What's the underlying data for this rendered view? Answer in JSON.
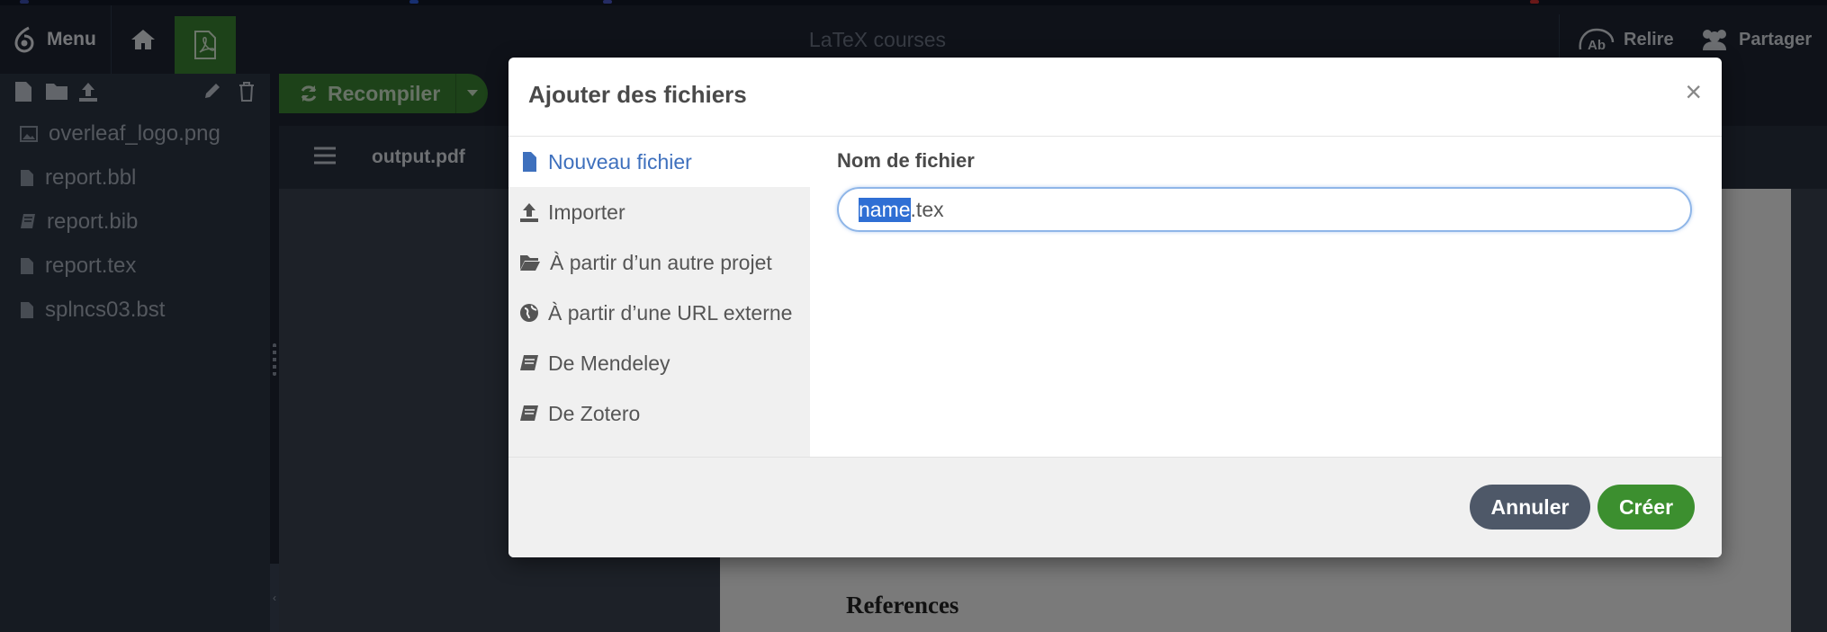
{
  "toolbar": {
    "menu_label": "Menu",
    "project_title": "LaTeX courses",
    "review_label": "Relire",
    "share_label": "Partager"
  },
  "sidebar": {
    "files": [
      {
        "name": "overleaf_logo.png",
        "icon": "image-icon"
      },
      {
        "name": "report.bbl",
        "icon": "file-icon"
      },
      {
        "name": "report.bib",
        "icon": "book-icon"
      },
      {
        "name": "report.tex",
        "icon": "file-icon"
      },
      {
        "name": "splncs03.bst",
        "icon": "file-icon"
      }
    ]
  },
  "pdf": {
    "recompile_label": "Recompiler",
    "output_filename": "output.pdf",
    "page_heading": "References"
  },
  "modal": {
    "title": "Ajouter des fichiers",
    "close_glyph": "×",
    "nav": [
      {
        "label": "Nouveau fichier",
        "icon": "file-icon",
        "active": true
      },
      {
        "label": "Importer",
        "icon": "upload-icon",
        "active": false
      },
      {
        "label": "À partir d’un autre projet",
        "icon": "folder-open-icon",
        "active": false
      },
      {
        "label": "À partir d’une URL externe",
        "icon": "globe-icon",
        "active": false
      },
      {
        "label": "De Mendeley",
        "icon": "book-icon",
        "active": false
      },
      {
        "label": "De Zotero",
        "icon": "book-icon",
        "active": false
      }
    ],
    "filename_label": "Nom de fichier",
    "filename_selected": "name",
    "filename_rest": ".tex",
    "cancel_label": "Annuler",
    "create_label": "Créer"
  },
  "colors": {
    "accent_green": "#3c8f2f",
    "link_blue": "#3e70bd",
    "dark_bg": "#1e2533"
  }
}
